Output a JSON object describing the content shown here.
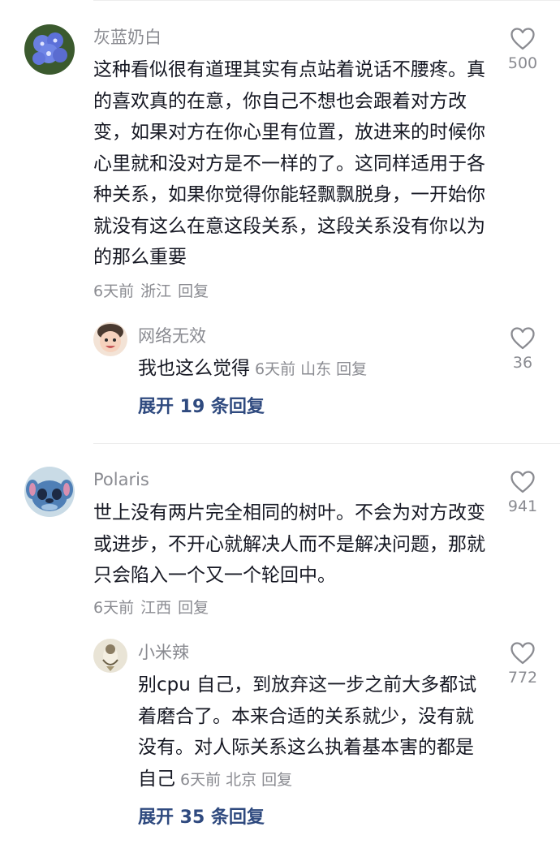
{
  "comments": [
    {
      "username": "灰蓝奶白",
      "text": "这种看似很有道理其实有点站着说话不腰疼。真的喜欢真的在意，你自己不想也会跟着对方改变，如果对方在你心里有位置，放进来的时候你心里就和没对方是不一样的了。这同样适用于各种关系，如果你觉得你能轻飘飘脱身，一开始你就没有这么在意这段关系，这段关系没有你以为的那么重要",
      "time": "6天前",
      "location": "浙江",
      "reply_label": "回复",
      "likes": "500",
      "reply": {
        "username": "网络无效",
        "text": "我也这么觉得",
        "time": "6天前",
        "location": "山东",
        "reply_label": "回复",
        "likes": "36"
      },
      "expand_label": "展开 19 条回复"
    },
    {
      "username": "Polaris",
      "text": "世上没有两片完全相同的树叶。不会为对方改变或进步，不开心就解决人而不是解决问题，那就只会陷入一个又一个轮回中。",
      "time": "6天前",
      "location": "江西",
      "reply_label": "回复",
      "likes": "941",
      "reply": {
        "username": "小米辣",
        "text": "别cpu 自己，到放弃这一步之前大多都试着磨合了。本来合适的关系就少，没有就没有。对人际关系这么执着基本害的都是自己",
        "time": "6天前",
        "location": "北京",
        "reply_label": "回复",
        "likes": "772"
      },
      "expand_label": "展开 35 条回复"
    }
  ],
  "colors": {
    "username": "#8a8b91",
    "text": "#161823",
    "expand": "#2f4a7f",
    "divider": "#ededed"
  },
  "icons": [
    "heart-outline-icon"
  ]
}
